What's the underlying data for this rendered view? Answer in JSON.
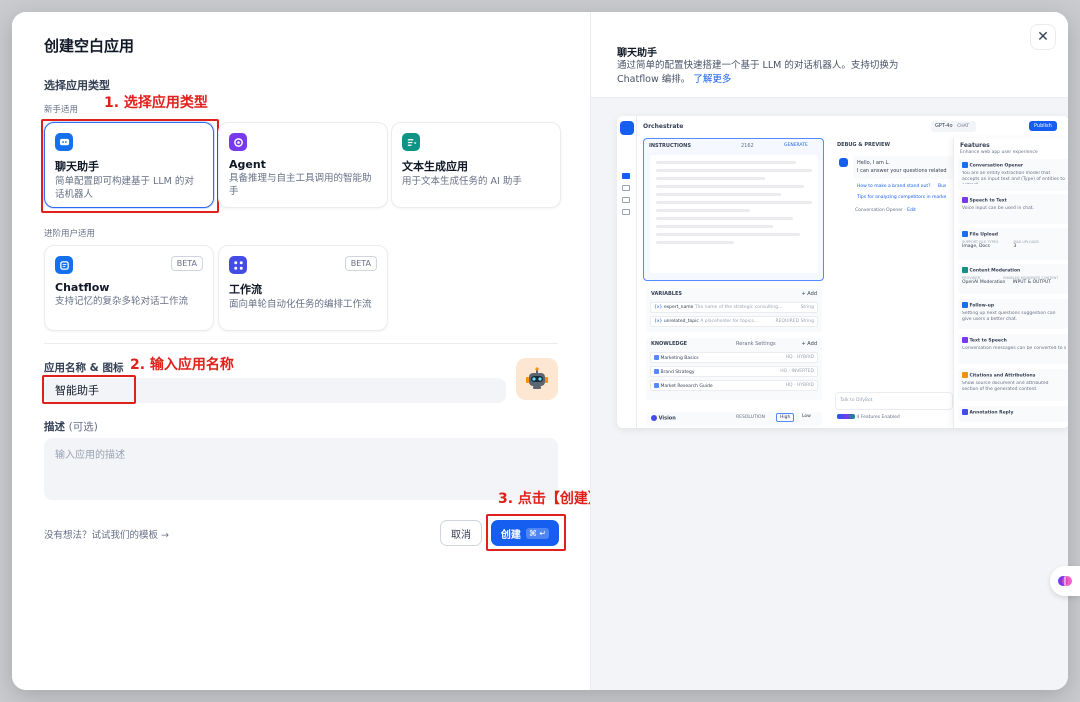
{
  "dialog": {
    "title": "创建空白应用",
    "app_type_label": "选择应用类型",
    "beginner_label": "新手适用",
    "advanced_label": "进阶用户适用",
    "close_icon": "close-icon"
  },
  "app_types": [
    {
      "name": "聊天助手",
      "desc": "简单配置即可构建基于 LLM 的对话机器人",
      "icon": "chat-bot-icon",
      "color": "#1570ef",
      "selected": true
    },
    {
      "name": "Agent",
      "desc": "具备推理与自主工具调用的智能助手",
      "icon": "agent-icon",
      "color": "#7839ee",
      "selected": false
    },
    {
      "name": "文本生成应用",
      "desc": "用于文本生成任务的 AI 助手",
      "icon": "text-generate-icon",
      "color": "#0e9384",
      "selected": false
    }
  ],
  "advanced_types": [
    {
      "name": "Chatflow",
      "desc": "支持记忆的复杂多轮对话工作流",
      "badge": "BETA",
      "icon": "chatflow-icon",
      "color": "#1570ef"
    },
    {
      "name": "工作流",
      "desc": "面向单轮自动化任务的编排工作流",
      "badge": "BETA",
      "icon": "workflow-icon",
      "color": "#444ce7"
    }
  ],
  "form": {
    "name_label": "应用名称 & 图标",
    "name_value": "智能助手",
    "desc_label": "描述",
    "desc_optional": "(可选)",
    "desc_placeholder": "输入应用的描述"
  },
  "footer": {
    "template_link": "没有想法？试试我们的模板 →",
    "cancel": "取消",
    "create": "创建",
    "shortcut": "⌘ ↵"
  },
  "annotations": {
    "step1": "1. 选择应用类型",
    "step2": "2. 输入应用名称",
    "step3": "3. 点击【创建】"
  },
  "preview_panel": {
    "title": "聊天助手",
    "desc": "通过简单的配置快速搭建一个基于 LLM 的对话机器人。支持切换为 Chatflow 编排。",
    "learn_more": "了解更多"
  },
  "preview": {
    "header": "Orchestrate",
    "model": "GPT-4o",
    "model_tag": "CHAT",
    "publish": "Publish",
    "instructions": "INSTRUCTIONS",
    "instructions_count": "2162",
    "generate": "GENERATE",
    "debug": "DEBUG & PREVIEW",
    "greeting": "Hello, I am L.",
    "greeting2": "I can answer your questions related",
    "suggest1": "How to make a brand stand out?",
    "suggest1b": "Bus",
    "suggest2": "Tips for analyzing competitors in marke",
    "opener": "Conversation Opener",
    "opener_edit": "Edit",
    "variables": "VARIABLES",
    "add": "+ Add",
    "var1": "expert_name",
    "var1_desc": "The name of the strategic consulting...",
    "var1_type": "String",
    "var2": "unrelated_topic",
    "var2_desc": "A placeholder for topics...",
    "var2_req": "REQUIRED",
    "var2_type": "String",
    "knowledge": "KNOWLEDGE",
    "rerank": "Rerank Settings",
    "kb1": "Marketing Basics",
    "kb2": "Brand Strategy",
    "kb3": "Market Research Guide",
    "kb1_tag": "HQ · HYBRID",
    "kb2_tag": "HQ · INVERTED",
    "kb3_tag": "HQ · HYBRID",
    "vision": "Vision",
    "resolution": "RESOLUTION",
    "high": "High",
    "low": "Low",
    "talk": "Talk to DifyBot",
    "features_enabled": "4 Features Enabled",
    "features_title": "Features",
    "features_sub": "Enhance web app user experience",
    "f1": "Conversation Opener",
    "f1d": "You are an entity extraction model that accepts an input text and (Type) of entities to extract.",
    "f2": "Speech to Text",
    "f2d": "Voice input can be used in chat.",
    "f3": "File Upload",
    "f3a": "SUPPORT FILE TYPES",
    "f3b": "Image, Docs",
    "f3c": "MAX UPLOADS",
    "f3e": "3",
    "f4": "Content Moderation",
    "f4a": "PROVIDER",
    "f4b": "OpenAI Moderation",
    "f4c": "ENABLED MODERATE CONTENT",
    "f4e": "INPUT & OUTPUT",
    "f5": "Follow-up",
    "f5d": "Setting up next questions suggestion can give users a better chat.",
    "f6": "Text to Speech",
    "f6d": "Conversation messages can be converted to speech.",
    "f7": "Citations and Attributions",
    "f7d": "Show source document and attributed section of the generated content.",
    "f8": "Annotation Reply"
  }
}
